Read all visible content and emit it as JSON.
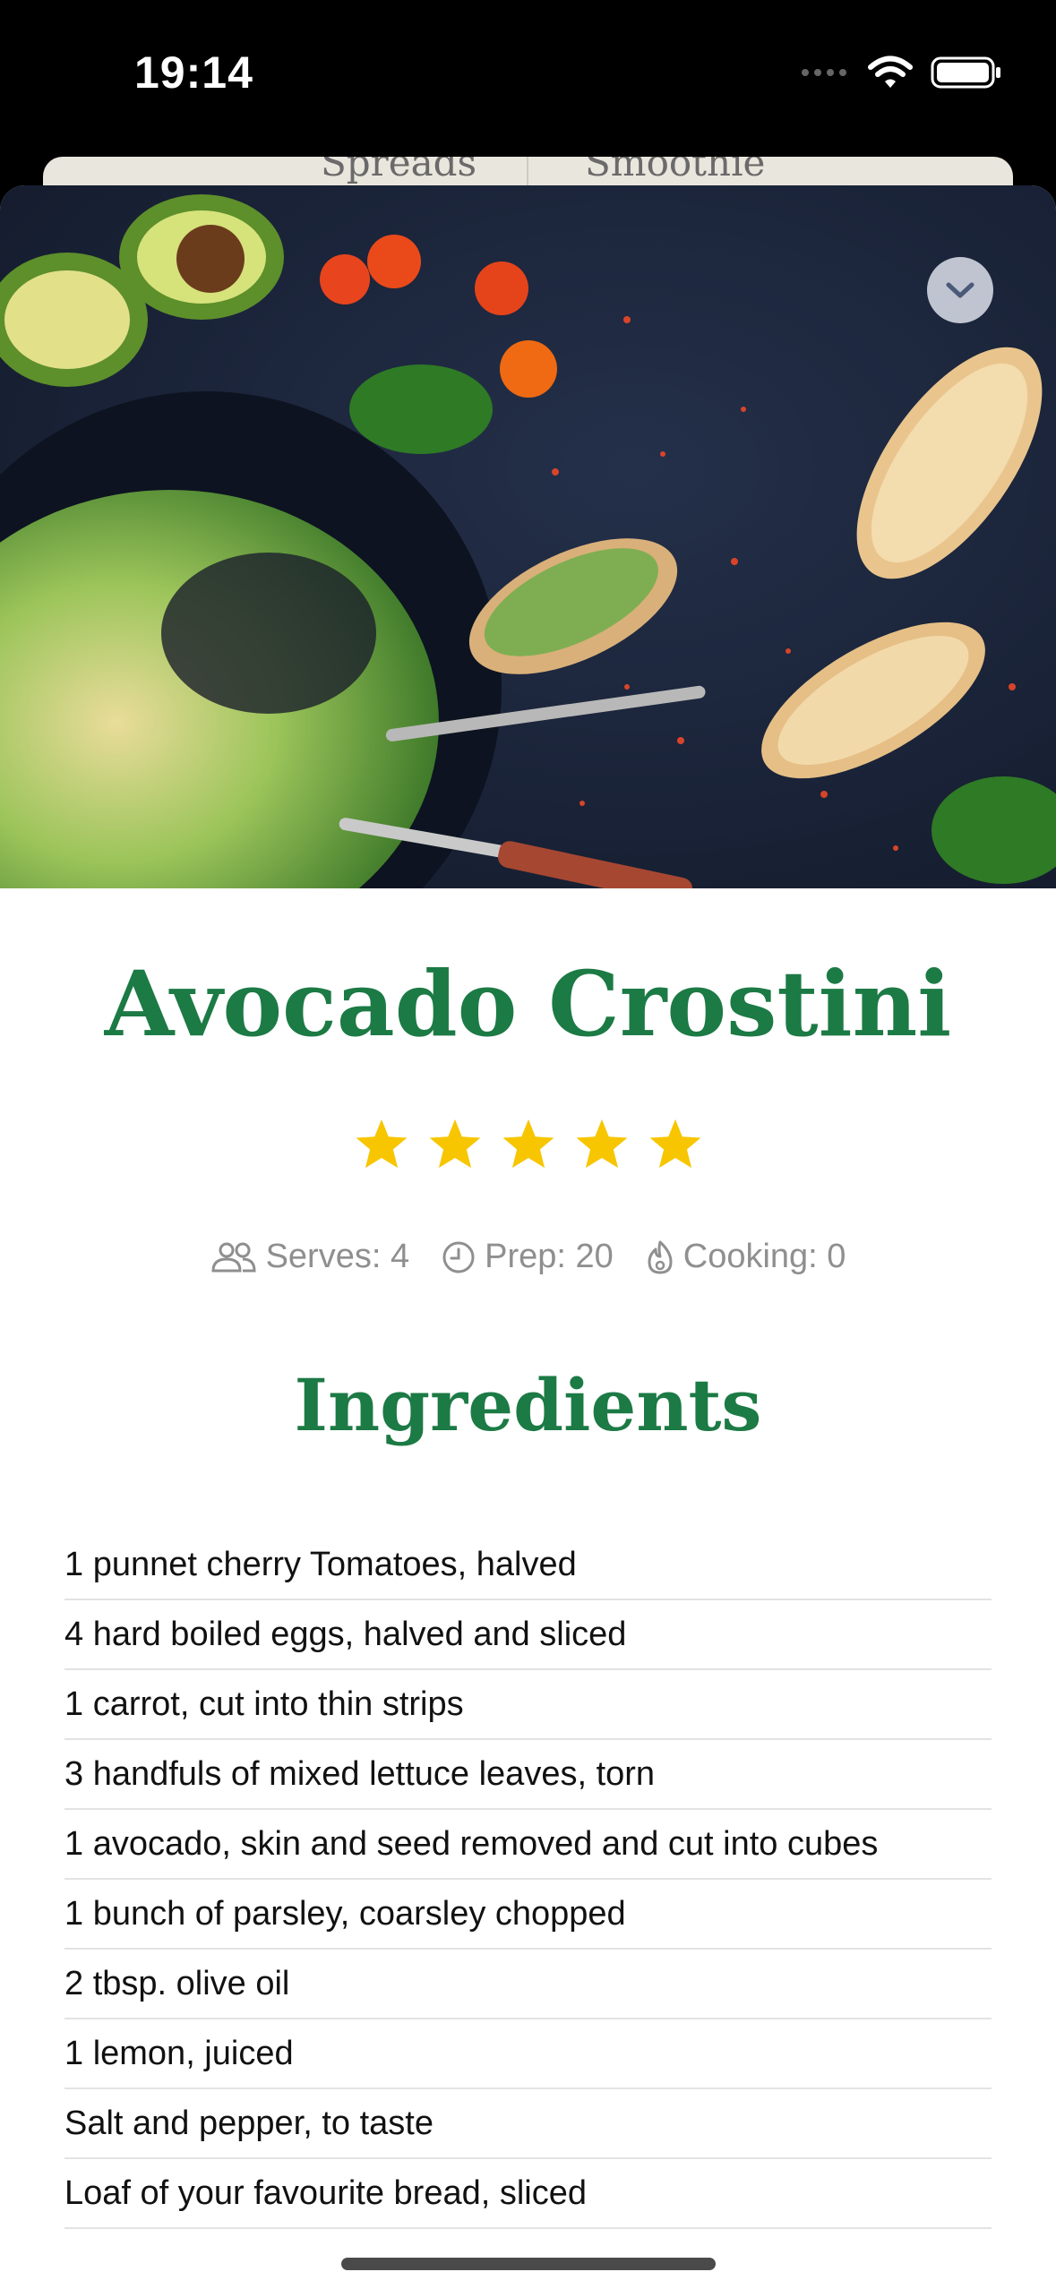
{
  "status_bar": {
    "time": "19:14",
    "icons": [
      "signal-icon",
      "wifi-icon",
      "battery-icon"
    ]
  },
  "background_tabs": {
    "labels": [
      "Spreads",
      "Smoothie"
    ]
  },
  "recipe": {
    "title": "Avocado Crostini",
    "rating": 5,
    "meta": {
      "serves": "Serves: 4",
      "prep": "Prep: 20",
      "cooking": "Cooking: 0"
    },
    "section_title": "Ingredients",
    "ingredients": [
      "1 punnet cherry Tomatoes, halved",
      "4 hard boiled eggs, halved and sliced",
      "1 carrot, cut into thin strips",
      "3 handfuls of mixed lettuce leaves, torn",
      "1 avocado, skin and seed removed and cut into cubes",
      "1 bunch of parsley, coarsley chopped",
      "2 tbsp. olive oil",
      "1 lemon, juiced",
      "Salt and pepper, to taste",
      "Loaf of your favourite bread, sliced"
    ]
  },
  "colors": {
    "accent": "#1c7a45",
    "star": "#f7c600",
    "meta_text": "#8f8f8f"
  }
}
